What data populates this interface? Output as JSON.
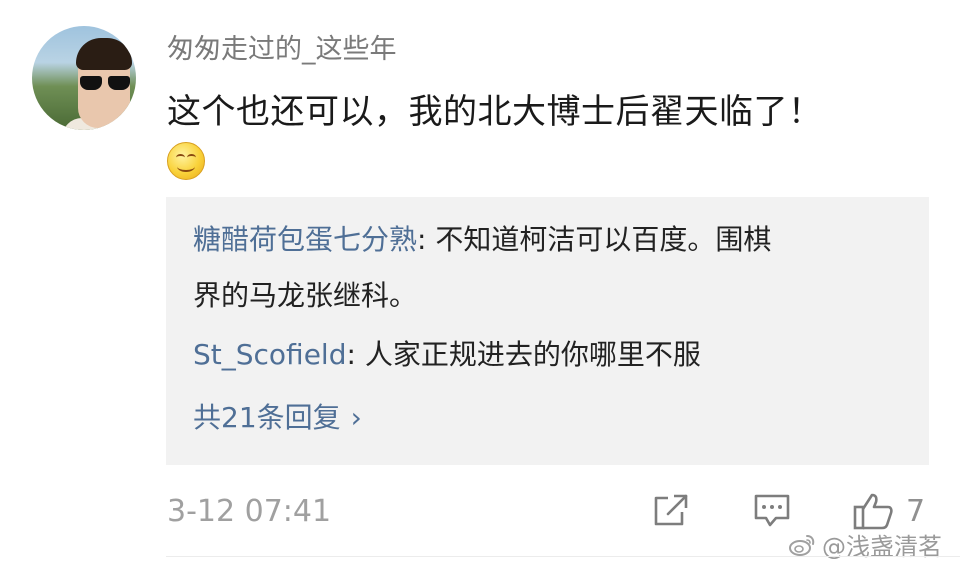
{
  "comment": {
    "username": "匆匆走过的_这些年",
    "text": "这个也还可以，我的北大博士后翟天临了！",
    "emoji_icon": "smile-emoji-icon"
  },
  "replies": {
    "items": [
      {
        "name": "糖醋荷包蛋七分熟",
        "separator": ": ",
        "text_line1": "不知道柯洁可以百度。围棋",
        "text_line2": "界的马龙张继科。"
      },
      {
        "name": "St_Scofield",
        "separator": ": ",
        "text_line1": "人家正规进去的你哪里不服"
      }
    ],
    "more_label": "共21条回复",
    "more_chevron": "›"
  },
  "footer": {
    "timestamp": "3-12 07:41",
    "share_icon": "share-icon",
    "comment_icon": "comment-icon",
    "like_icon": "thumbs-up-icon",
    "like_count": "7"
  },
  "watermark": {
    "text": "@浅盏清茗",
    "icon": "weibo-icon"
  }
}
